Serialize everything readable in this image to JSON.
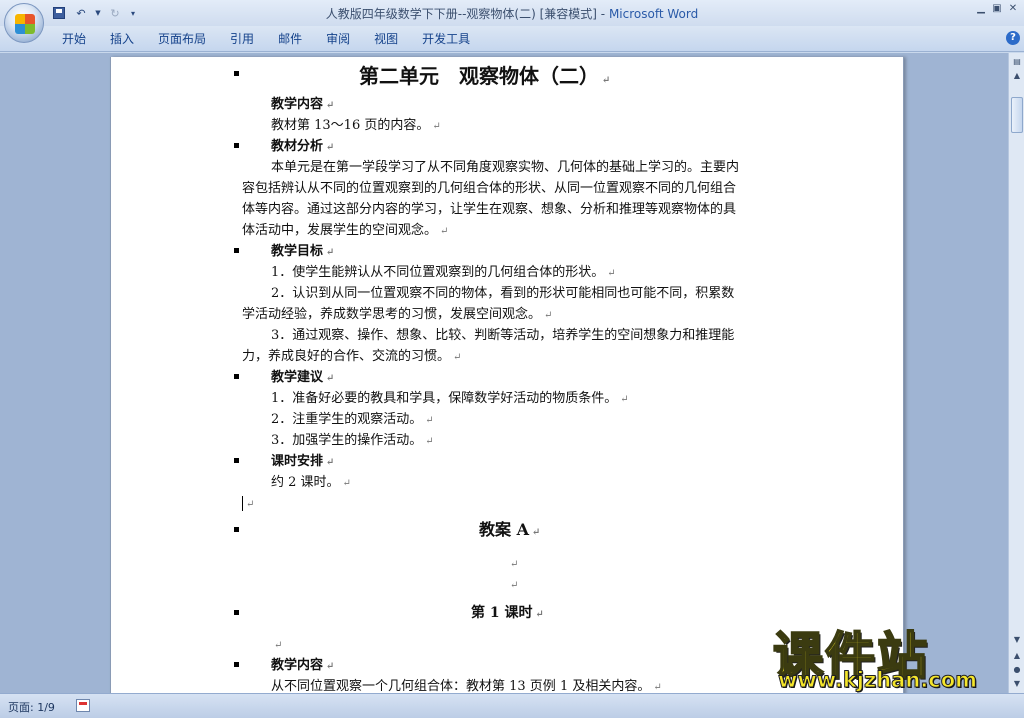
{
  "window": {
    "doc_name": "人教版四年级数学下下册--观察物体(二) [兼容模式] - ",
    "app_name": "Microsoft Word"
  },
  "ribbon": {
    "tabs": [
      "开始",
      "插入",
      "页面布局",
      "引用",
      "邮件",
      "审阅",
      "视图",
      "开发工具"
    ]
  },
  "document": {
    "heading": "第二单元　观察物体（二）",
    "sec1_title": "教学内容",
    "sec1_text": "教材第 13～16 页的内容。",
    "sec2_title": "教材分析",
    "sec2_lines": [
      "本单元是在第一学段学习了从不同角度观察实物、几何体的基础上学习的。主要内",
      "容包括辨认从不同的位置观察到的几何组合体的形状、从同一位置观察不同的几何组合",
      "体等内容。通过这部分内容的学习，让学生在观察、想象、分析和推理等观察物体的具",
      "体活动中，发展学生的空间观念。"
    ],
    "sec3_title": "教学目标",
    "sec3_lines": [
      "1．使学生能辨认从不同位置观察到的几何组合体的形状。",
      "2．认识到从同一位置观察不同的物体，看到的形状可能相同也可能不同，积累数",
      "学活动经验，养成数学思考的习惯，发展空间观念。",
      "3．通过观察、操作、想象、比较、判断等活动，培养学生的空间想象力和推理能",
      "力，养成良好的合作、交流的习惯。"
    ],
    "sec4_title": "教学建议",
    "sec4_lines": [
      "1．准备好必要的教具和学具，保障数学好活动的物质条件。",
      "2．注重学生的观察活动。",
      "3．加强学生的操作活动。"
    ],
    "sec5_title": "课时安排",
    "sec5_text": "约 2 课时。",
    "lesson_plan_title": "教案 A",
    "lesson_title": "第 1 课时",
    "sec6_title": "教学内容",
    "sec6_text": "从不同位置观察一个几何组合体：教材第 13 页例 1 及相关内容。"
  },
  "statusbar": {
    "page": "页面: 1/9"
  },
  "watermark": {
    "logo": "课件站",
    "url": "www.kjzhan.com"
  }
}
